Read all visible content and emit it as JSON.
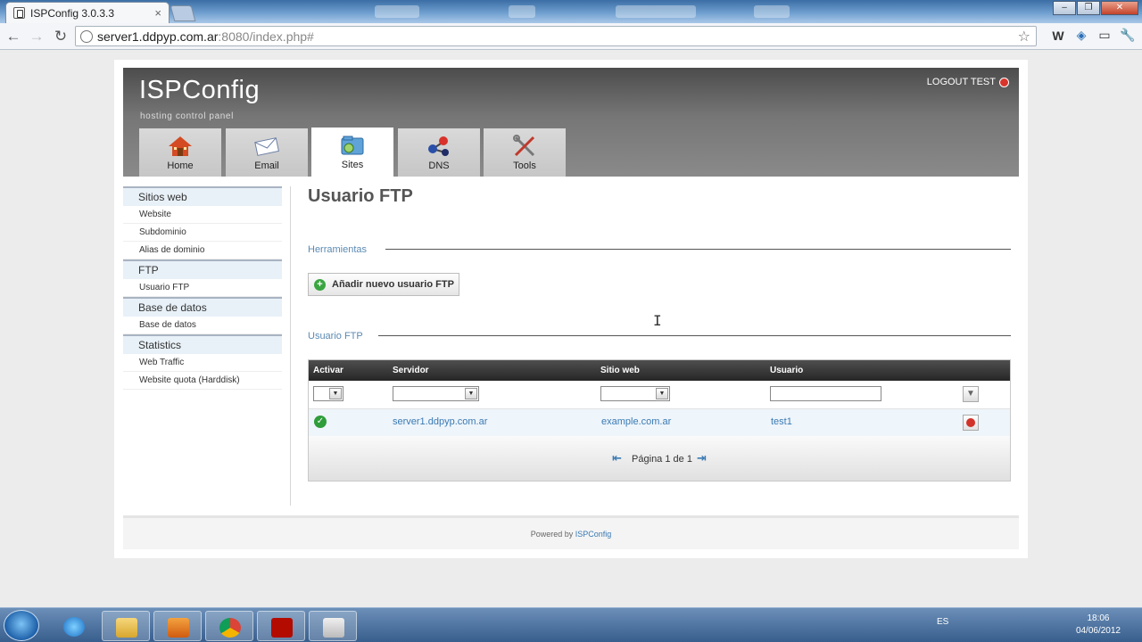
{
  "browser": {
    "tab_title": "ISPConfig 3.0.3.3",
    "url_host": "server1.ddpyp.com.ar",
    "url_rest": ":8080/index.php#"
  },
  "header": {
    "logo": "ISPConfig",
    "subtitle": "hosting control panel",
    "logout": "LOGOUT TEST"
  },
  "nav": {
    "tabs": [
      {
        "label": "Home"
      },
      {
        "label": "Email"
      },
      {
        "label": "Sites"
      },
      {
        "label": "DNS"
      },
      {
        "label": "Tools"
      }
    ]
  },
  "sidebar": {
    "sections": [
      {
        "title": "Sitios web",
        "items": [
          "Website",
          "Subdominio",
          "Alias de dominio"
        ]
      },
      {
        "title": "FTP",
        "items": [
          "Usuario FTP"
        ]
      },
      {
        "title": "Base de datos",
        "items": [
          "Base de datos"
        ]
      },
      {
        "title": "Statistics",
        "items": [
          "Web Traffic",
          "Website quota (Harddisk)"
        ]
      }
    ]
  },
  "main": {
    "title": "Usuario FTP",
    "tools_legend": "Herramientas",
    "add_button": "Añadir nuevo usuario FTP",
    "list_legend": "Usuario FTP",
    "columns": [
      "Activar",
      "Servidor",
      "Sitio web",
      "Usuario"
    ],
    "rows": [
      {
        "active": true,
        "server": "server1.ddpyp.com.ar",
        "website": "example.com.ar",
        "user": "test1"
      }
    ],
    "pagination": "Página 1 de 1"
  },
  "footer": {
    "text": "Powered by",
    "link": "ISPConfig"
  },
  "taskbar": {
    "lang": "ES",
    "time": "18:06",
    "date": "04/06/2012"
  },
  "colors": {
    "accent_link": "#3a7ab3",
    "header_dark": "#4c4c4c",
    "sidebar_section_bg": "#e8f1f8"
  }
}
